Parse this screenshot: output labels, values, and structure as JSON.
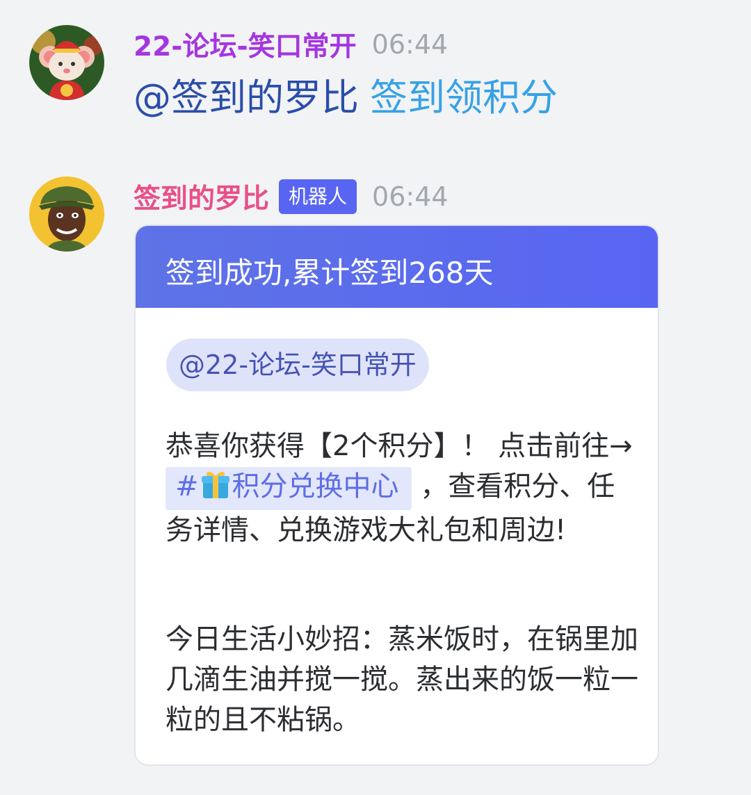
{
  "messages": [
    {
      "sender": "22-论坛-笑口常开",
      "time": "06:44",
      "mention": "@签到的罗比",
      "link": "签到领积分"
    },
    {
      "sender": "签到的罗比",
      "badge": "机器人",
      "time": "06:44",
      "card": {
        "title": "签到成功,累计签到268天",
        "mention": "@22-论坛-笑口常开",
        "para1_before": "恭喜你获得【2个积分】！ 点击前往→ ",
        "channel_hash": "#",
        "channel_name": "积分兑换中心",
        "para1_after": " ，查看积分、任务详情、兑换游戏大礼包和周边!",
        "para2": "今日生活小妙招：蒸米饭时，在锅里加几滴生油并搅一搅。蒸出来的饭一粒一粒的且不粘锅。"
      }
    }
  ],
  "colors": {
    "sender1": "#a436e0",
    "sender2": "#e84f87",
    "accent": "#5865f2"
  },
  "icons": [
    "mouse-mascot-avatar",
    "bot-character-avatar",
    "gift-icon"
  ]
}
